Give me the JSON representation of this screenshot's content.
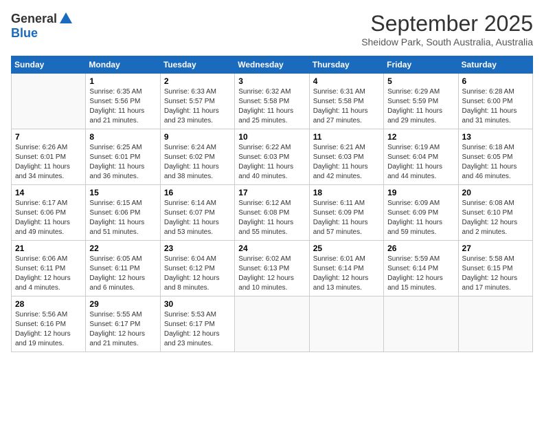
{
  "logo": {
    "general": "General",
    "blue": "Blue"
  },
  "title": "September 2025",
  "location": "Sheidow Park, South Australia, Australia",
  "days_header": [
    "Sunday",
    "Monday",
    "Tuesday",
    "Wednesday",
    "Thursday",
    "Friday",
    "Saturday"
  ],
  "weeks": [
    [
      {
        "day": "",
        "sunrise": "",
        "sunset": "",
        "daylight": ""
      },
      {
        "day": "1",
        "sunrise": "Sunrise: 6:35 AM",
        "sunset": "Sunset: 5:56 PM",
        "daylight": "Daylight: 11 hours and 21 minutes."
      },
      {
        "day": "2",
        "sunrise": "Sunrise: 6:33 AM",
        "sunset": "Sunset: 5:57 PM",
        "daylight": "Daylight: 11 hours and 23 minutes."
      },
      {
        "day": "3",
        "sunrise": "Sunrise: 6:32 AM",
        "sunset": "Sunset: 5:58 PM",
        "daylight": "Daylight: 11 hours and 25 minutes."
      },
      {
        "day": "4",
        "sunrise": "Sunrise: 6:31 AM",
        "sunset": "Sunset: 5:58 PM",
        "daylight": "Daylight: 11 hours and 27 minutes."
      },
      {
        "day": "5",
        "sunrise": "Sunrise: 6:29 AM",
        "sunset": "Sunset: 5:59 PM",
        "daylight": "Daylight: 11 hours and 29 minutes."
      },
      {
        "day": "6",
        "sunrise": "Sunrise: 6:28 AM",
        "sunset": "Sunset: 6:00 PM",
        "daylight": "Daylight: 11 hours and 31 minutes."
      }
    ],
    [
      {
        "day": "7",
        "sunrise": "Sunrise: 6:26 AM",
        "sunset": "Sunset: 6:01 PM",
        "daylight": "Daylight: 11 hours and 34 minutes."
      },
      {
        "day": "8",
        "sunrise": "Sunrise: 6:25 AM",
        "sunset": "Sunset: 6:01 PM",
        "daylight": "Daylight: 11 hours and 36 minutes."
      },
      {
        "day": "9",
        "sunrise": "Sunrise: 6:24 AM",
        "sunset": "Sunset: 6:02 PM",
        "daylight": "Daylight: 11 hours and 38 minutes."
      },
      {
        "day": "10",
        "sunrise": "Sunrise: 6:22 AM",
        "sunset": "Sunset: 6:03 PM",
        "daylight": "Daylight: 11 hours and 40 minutes."
      },
      {
        "day": "11",
        "sunrise": "Sunrise: 6:21 AM",
        "sunset": "Sunset: 6:03 PM",
        "daylight": "Daylight: 11 hours and 42 minutes."
      },
      {
        "day": "12",
        "sunrise": "Sunrise: 6:19 AM",
        "sunset": "Sunset: 6:04 PM",
        "daylight": "Daylight: 11 hours and 44 minutes."
      },
      {
        "day": "13",
        "sunrise": "Sunrise: 6:18 AM",
        "sunset": "Sunset: 6:05 PM",
        "daylight": "Daylight: 11 hours and 46 minutes."
      }
    ],
    [
      {
        "day": "14",
        "sunrise": "Sunrise: 6:17 AM",
        "sunset": "Sunset: 6:06 PM",
        "daylight": "Daylight: 11 hours and 49 minutes."
      },
      {
        "day": "15",
        "sunrise": "Sunrise: 6:15 AM",
        "sunset": "Sunset: 6:06 PM",
        "daylight": "Daylight: 11 hours and 51 minutes."
      },
      {
        "day": "16",
        "sunrise": "Sunrise: 6:14 AM",
        "sunset": "Sunset: 6:07 PM",
        "daylight": "Daylight: 11 hours and 53 minutes."
      },
      {
        "day": "17",
        "sunrise": "Sunrise: 6:12 AM",
        "sunset": "Sunset: 6:08 PM",
        "daylight": "Daylight: 11 hours and 55 minutes."
      },
      {
        "day": "18",
        "sunrise": "Sunrise: 6:11 AM",
        "sunset": "Sunset: 6:09 PM",
        "daylight": "Daylight: 11 hours and 57 minutes."
      },
      {
        "day": "19",
        "sunrise": "Sunrise: 6:09 AM",
        "sunset": "Sunset: 6:09 PM",
        "daylight": "Daylight: 11 hours and 59 minutes."
      },
      {
        "day": "20",
        "sunrise": "Sunrise: 6:08 AM",
        "sunset": "Sunset: 6:10 PM",
        "daylight": "Daylight: 12 hours and 2 minutes."
      }
    ],
    [
      {
        "day": "21",
        "sunrise": "Sunrise: 6:06 AM",
        "sunset": "Sunset: 6:11 PM",
        "daylight": "Daylight: 12 hours and 4 minutes."
      },
      {
        "day": "22",
        "sunrise": "Sunrise: 6:05 AM",
        "sunset": "Sunset: 6:11 PM",
        "daylight": "Daylight: 12 hours and 6 minutes."
      },
      {
        "day": "23",
        "sunrise": "Sunrise: 6:04 AM",
        "sunset": "Sunset: 6:12 PM",
        "daylight": "Daylight: 12 hours and 8 minutes."
      },
      {
        "day": "24",
        "sunrise": "Sunrise: 6:02 AM",
        "sunset": "Sunset: 6:13 PM",
        "daylight": "Daylight: 12 hours and 10 minutes."
      },
      {
        "day": "25",
        "sunrise": "Sunrise: 6:01 AM",
        "sunset": "Sunset: 6:14 PM",
        "daylight": "Daylight: 12 hours and 13 minutes."
      },
      {
        "day": "26",
        "sunrise": "Sunrise: 5:59 AM",
        "sunset": "Sunset: 6:14 PM",
        "daylight": "Daylight: 12 hours and 15 minutes."
      },
      {
        "day": "27",
        "sunrise": "Sunrise: 5:58 AM",
        "sunset": "Sunset: 6:15 PM",
        "daylight": "Daylight: 12 hours and 17 minutes."
      }
    ],
    [
      {
        "day": "28",
        "sunrise": "Sunrise: 5:56 AM",
        "sunset": "Sunset: 6:16 PM",
        "daylight": "Daylight: 12 hours and 19 minutes."
      },
      {
        "day": "29",
        "sunrise": "Sunrise: 5:55 AM",
        "sunset": "Sunset: 6:17 PM",
        "daylight": "Daylight: 12 hours and 21 minutes."
      },
      {
        "day": "30",
        "sunrise": "Sunrise: 5:53 AM",
        "sunset": "Sunset: 6:17 PM",
        "daylight": "Daylight: 12 hours and 23 minutes."
      },
      {
        "day": "",
        "sunrise": "",
        "sunset": "",
        "daylight": ""
      },
      {
        "day": "",
        "sunrise": "",
        "sunset": "",
        "daylight": ""
      },
      {
        "day": "",
        "sunrise": "",
        "sunset": "",
        "daylight": ""
      },
      {
        "day": "",
        "sunrise": "",
        "sunset": "",
        "daylight": ""
      }
    ]
  ]
}
